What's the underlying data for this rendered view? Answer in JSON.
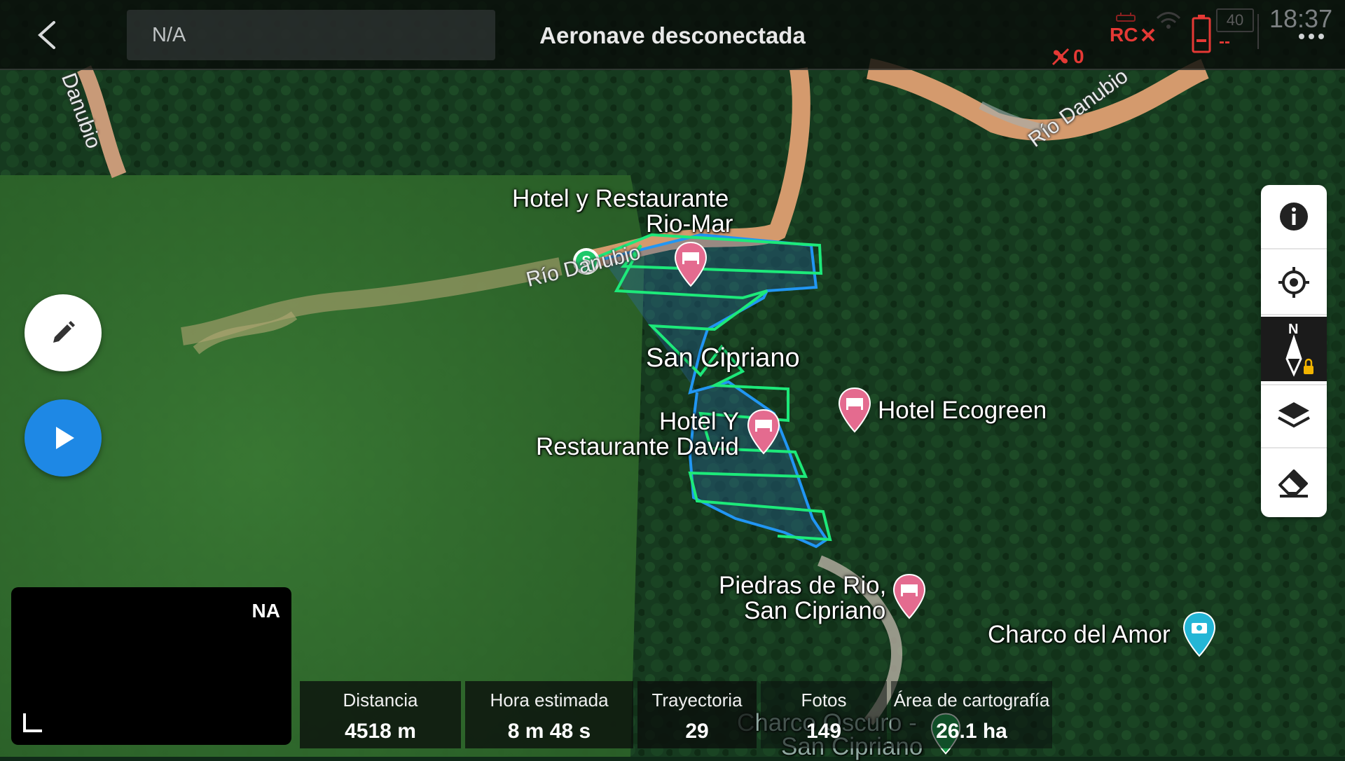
{
  "topbar": {
    "status_field": "N/A",
    "title": "Aeronave desconectada",
    "motor_count": "0",
    "rc_label": "RC",
    "battery_value": "--",
    "rc_battery": "40",
    "time": "18:37"
  },
  "map": {
    "labels": {
      "hotel_rio_mar_line1": "Hotel y Restaurante",
      "hotel_rio_mar_line2": "Rio-Mar",
      "san_cipriano": "San Cipriano",
      "hotel_david_line1": "Hotel Y",
      "hotel_david_line2": "Restaurante David",
      "hotel_ecogreen": "Hotel Ecogreen",
      "piedras_line1": "Piedras de Rio,",
      "piedras_line2": "San Cipriano",
      "charco_amor": "Charco del Amor",
      "charco_oscuro_line1": "Charco Oscuro -",
      "charco_oscuro_line2": "San Cipriano",
      "rio_danubio_ne": "Río Danubio",
      "rio_danubio_w": "Río Danubio",
      "rio_danubio_nw": "Danubio"
    },
    "start_marker": "S",
    "colors": {
      "area_outline": "#2196f3",
      "flight_path": "#1de97a",
      "hotel_pin": "#e46b8f",
      "attraction_pin": "#24b6d6"
    }
  },
  "preview": {
    "badge": "NA"
  },
  "stats": [
    {
      "label": "Distancia",
      "value": "4518 m"
    },
    {
      "label": "Hora estimada",
      "value": "8 m 48 s"
    },
    {
      "label": "Trayectoria",
      "value": "29"
    },
    {
      "label": "Fotos",
      "value": "149"
    },
    {
      "label": "Área de cartografía",
      "value": "26.1 ha"
    }
  ]
}
